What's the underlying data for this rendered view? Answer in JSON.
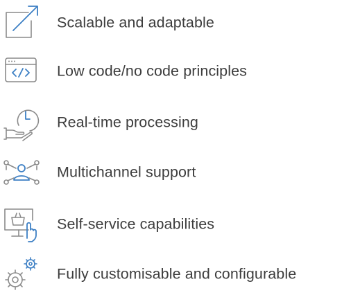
{
  "colors": {
    "icon_stroke": "#8a8a8a",
    "icon_accent": "#3c7fc4",
    "text": "#3d3d3d"
  },
  "features": [
    {
      "icon": "scale-arrow-icon",
      "label": "Scalable and adaptable"
    },
    {
      "icon": "code-window-icon",
      "label": "Low code/no code principles"
    },
    {
      "icon": "clock-hand-icon",
      "label": "Real-time processing"
    },
    {
      "icon": "network-people-icon",
      "label": "Multichannel support"
    },
    {
      "icon": "self-service-kiosk-icon",
      "label": "Self-service capabilities"
    },
    {
      "icon": "gears-icon",
      "label": "Fully customisable and configurable"
    }
  ]
}
